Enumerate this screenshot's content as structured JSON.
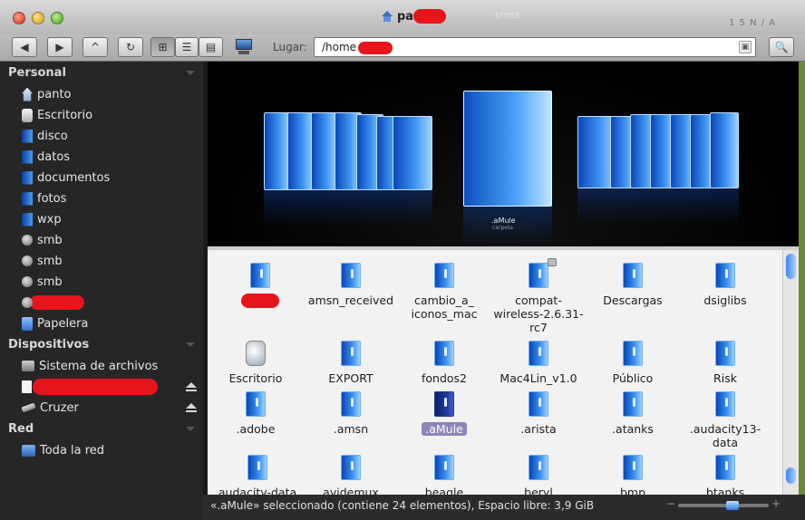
{
  "window": {
    "title": "pa",
    "title_redacted": true,
    "ghost_text": "smss",
    "ghost_clock": "1 5   N / A"
  },
  "toolbar": {
    "back_label": "◀",
    "forward_label": "▶",
    "up_label": "^",
    "reload_label": "↻",
    "view_icons_label": "⊞",
    "view_list_label": "☰",
    "view_columns_label": "▤",
    "location_label": "Lugar:",
    "path_value": "/home",
    "path_redacted": true,
    "search_label": "🔍"
  },
  "sidebar": {
    "personal_header": "Personal",
    "personal_items": [
      {
        "label": "panto",
        "icon": "home-icon"
      },
      {
        "label": "Escritorio",
        "icon": "desktop-icon"
      },
      {
        "label": "disco",
        "icon": "folder-icon"
      },
      {
        "label": "datos",
        "icon": "folder-icon"
      },
      {
        "label": "documentos",
        "icon": "folder-icon"
      },
      {
        "label": "fotos",
        "icon": "folder-icon"
      },
      {
        "label": "wxp",
        "icon": "folder-icon"
      },
      {
        "label": "smb",
        "icon": "network-share-icon"
      },
      {
        "label": "smb",
        "icon": "network-share-icon"
      },
      {
        "label": "smb",
        "icon": "network-share-icon"
      },
      {
        "label": "",
        "icon": "network-share-icon",
        "redacted": true
      },
      {
        "label": "Papelera",
        "icon": "trash-icon"
      }
    ],
    "devices_header": "Dispositivos",
    "device_items": [
      {
        "label": "Sistema de archivos",
        "icon": "hard-drive-icon"
      },
      {
        "label": "",
        "icon": "drive-icon",
        "redacted": true,
        "eject": true
      },
      {
        "label": "Cruzer",
        "icon": "usb-icon",
        "eject": true
      }
    ],
    "network_header": "Red",
    "network_items": [
      {
        "label": "Toda la red",
        "icon": "network-icon"
      }
    ]
  },
  "coverflow": {
    "label": ".aMule",
    "sublabel": "carpeta"
  },
  "files": [
    {
      "label": "",
      "redacted": true
    },
    {
      "label": "amsn_received"
    },
    {
      "label": "cambio_a_\niconos_mac"
    },
    {
      "label": "compat-\nwireless-2.6.31-\nrc7",
      "locked": true
    },
    {
      "label": "Descargas"
    },
    {
      "label": "dsiglibs"
    },
    {
      "label": "Escritorio",
      "desktop": true
    },
    {
      "label": "EXPORT"
    },
    {
      "label": "fondos2"
    },
    {
      "label": "Mac4Lin_v1.0"
    },
    {
      "label": "Público"
    },
    {
      "label": "Risk"
    },
    {
      "label": ".adobe"
    },
    {
      "label": ".amsn"
    },
    {
      "label": ".aMule",
      "selected": true
    },
    {
      "label": ".arista"
    },
    {
      "label": ".atanks"
    },
    {
      "label": ".audacity13-\ndata"
    },
    {
      "label": "audacity-data"
    },
    {
      "label": "avidemux"
    },
    {
      "label": "beagle"
    },
    {
      "label": "beryl"
    },
    {
      "label": "bmp"
    },
    {
      "label": "btanks"
    }
  ],
  "status": {
    "text": "«.aMule» seleccionado (contiene 24 elementos), Espacio libre: 3,9 GiB",
    "zoom_minus": "−",
    "zoom_plus": "+",
    "zoom_level": 0.6
  },
  "colors": {
    "accent": "#3a92f0",
    "sidebar_bg": "#262626",
    "selection": "#8c86b8",
    "redaction": "#e8141c"
  }
}
